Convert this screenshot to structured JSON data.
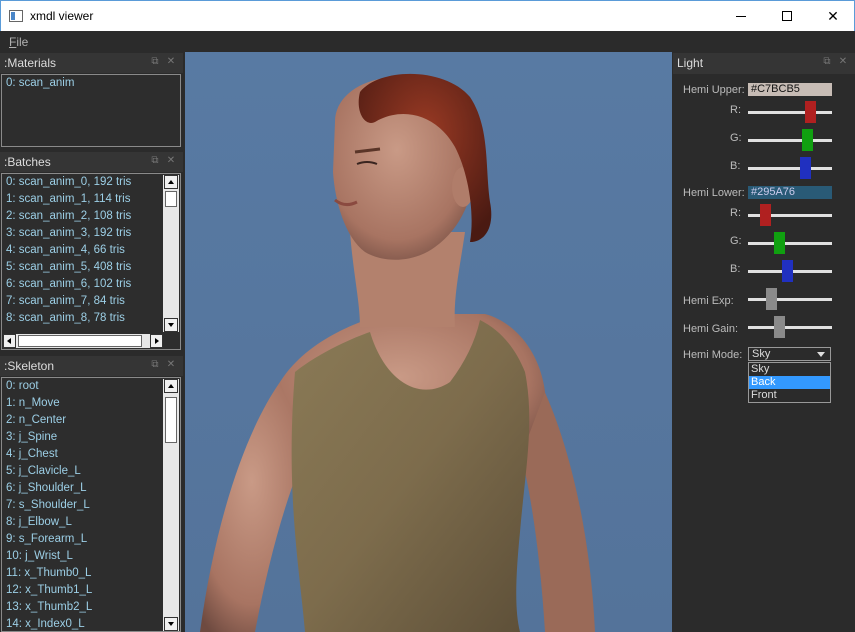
{
  "window": {
    "title": "xmdl viewer"
  },
  "menu": {
    "file_accel": "F",
    "file_rest": "ile"
  },
  "materials": {
    "title": ":Materials",
    "items": [
      "0: scan_anim"
    ]
  },
  "batches": {
    "title": ":Batches",
    "items": [
      "0: scan_anim_0, 192 tris",
      "1: scan_anim_1, 114 tris",
      "2: scan_anim_2, 108 tris",
      "3: scan_anim_3, 192 tris",
      "4: scan_anim_4, 66 tris",
      "5: scan_anim_5, 408 tris",
      "6: scan_anim_6, 102 tris",
      "7: scan_anim_7, 84 tris",
      "8: scan_anim_8, 78 tris"
    ]
  },
  "skeleton": {
    "title": ":Skeleton",
    "items": [
      "0: root",
      "1: n_Move",
      "2: n_Center",
      "3: j_Spine",
      "4: j_Chest",
      "5: j_Clavicle_L",
      "6: j_Shoulder_L",
      "7: s_Shoulder_L",
      "8: j_Elbow_L",
      "9: s_Forearm_L",
      "10: j_Wrist_L",
      "11: x_Thumb0_L",
      "12: x_Thumb1_L",
      "13: x_Thumb2_L",
      "14: x_Index0_L"
    ]
  },
  "light": {
    "title": "Light",
    "hemi_upper_label": "Hemi Upper:",
    "hemi_upper_value": "#C7BCB5",
    "hemi_upper_color": "#C7BCB5",
    "hemi_lower_label": "Hemi Lower:",
    "hemi_lower_value": "#295A76",
    "hemi_lower_color": "#295A76",
    "r_label": "R:",
    "g_label": "G:",
    "b_label": "B:",
    "hemi_exp_label": "Hemi Exp:",
    "hemi_gain_label": "Hemi Gain:",
    "hemi_mode_label": "Hemi Mode:",
    "hemi_mode_value": "Sky",
    "hemi_mode_options": [
      "Sky",
      "Back",
      "Front"
    ],
    "hemi_mode_highlighted": "Back",
    "upper_sliders": {
      "r": 0.78,
      "g": 0.74,
      "b": 0.71
    },
    "lower_sliders": {
      "r": 0.16,
      "g": 0.35,
      "b": 0.46
    },
    "hemi_exp_slider": 0.25,
    "hemi_gain_slider": 0.35
  },
  "colors": {
    "slider_r": "#b02020",
    "slider_g": "#10a010",
    "slider_b": "#2030c0",
    "slider_gray": "#8a8a8a",
    "list_text": "#9ccfe6",
    "viewport_bg": "#5a7aa0"
  }
}
